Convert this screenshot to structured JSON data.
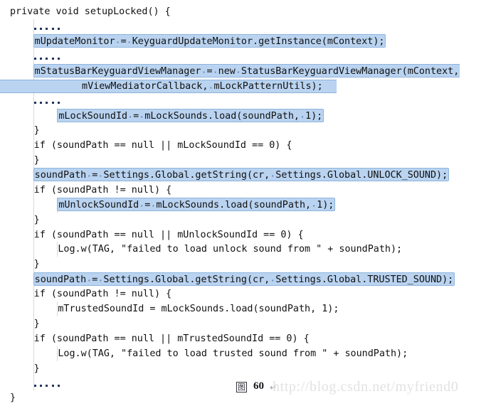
{
  "document": {
    "kind": "source-code-listing",
    "language": "java",
    "background_color": "#ffffff",
    "text_color": "#111111",
    "highlight_fill": "#b9d3f0",
    "highlight_border": "#8fb4de",
    "indent_guide_color": "#d8d8d8",
    "elision_dot_color": "#20355c",
    "watermark_color": "#e2e2e2"
  },
  "code": {
    "lines": [
      {
        "id": "l01",
        "indent": 0,
        "text": "private void setupLocked() {"
      },
      {
        "id": "l02",
        "indent": 4,
        "elision": true
      },
      {
        "id": "l03",
        "indent": 4,
        "text": "mUpdateMonitor = KeyguardUpdateMonitor.getInstance(mContext);",
        "highlight": "full"
      },
      {
        "id": "l04",
        "indent": 4,
        "elision": true
      },
      {
        "id": "l05",
        "indent": 4,
        "text": "mStatusBarKeyguardViewManager = new StatusBarKeyguardViewManager(mContext,",
        "highlight": "bleed-right"
      },
      {
        "id": "l06",
        "indent": 12,
        "text": "mViewMediatorCallback, mLockPatternUtils);",
        "highlight": "band"
      },
      {
        "id": "l07",
        "indent": 4,
        "elision": true
      },
      {
        "id": "l08",
        "indent": 8,
        "text": "mLockSoundId = mLockSounds.load(soundPath, 1);",
        "highlight": "full"
      },
      {
        "id": "l09",
        "indent": 4,
        "text": "}"
      },
      {
        "id": "l10",
        "indent": 4,
        "text": "if (soundPath == null || mLockSoundId == 0) {"
      },
      {
        "id": "l11",
        "indent": 4,
        "text": "}"
      },
      {
        "id": "l12",
        "indent": 4,
        "text": "soundPath = Settings.Global.getString(cr, Settings.Global.UNLOCK_SOUND);",
        "highlight": "full"
      },
      {
        "id": "l13",
        "indent": 4,
        "text": "if (soundPath != null) {"
      },
      {
        "id": "l14",
        "indent": 8,
        "text": "mUnlockSoundId = mLockSounds.load(soundPath, 1);",
        "highlight": "full"
      },
      {
        "id": "l15",
        "indent": 4,
        "text": "}"
      },
      {
        "id": "l16",
        "indent": 4,
        "text": "if (soundPath == null || mUnlockSoundId == 0) {"
      },
      {
        "id": "l17",
        "indent": 8,
        "text": "Log.w(TAG, \"failed to load unlock sound from \" + soundPath);"
      },
      {
        "id": "l18",
        "indent": 4,
        "text": "}"
      },
      {
        "id": "l19",
        "indent": 4,
        "text": "soundPath = Settings.Global.getString(cr, Settings.Global.TRUSTED_SOUND);",
        "highlight": "full"
      },
      {
        "id": "l20",
        "indent": 4,
        "text": "if (soundPath != null) {"
      },
      {
        "id": "l21",
        "indent": 8,
        "text": "mTrustedSoundId = mLockSounds.load(soundPath, 1);"
      },
      {
        "id": "l22",
        "indent": 4,
        "text": "}"
      },
      {
        "id": "l23",
        "indent": 4,
        "text": "if (soundPath == null || mTrustedSoundId == 0) {"
      },
      {
        "id": "l24",
        "indent": 8,
        "text": "Log.w(TAG, \"failed to load trusted sound from \" + soundPath);"
      },
      {
        "id": "l25",
        "indent": 4,
        "text": "}"
      },
      {
        "id": "l26",
        "indent": 4,
        "elision": true
      },
      {
        "id": "l27",
        "indent": 0,
        "text": "}"
      }
    ]
  },
  "caption": {
    "glyph": "图",
    "number": "60",
    "pilcrow": "↵"
  },
  "watermark": {
    "url": "http://blog.csdn.net/myfriend0"
  }
}
